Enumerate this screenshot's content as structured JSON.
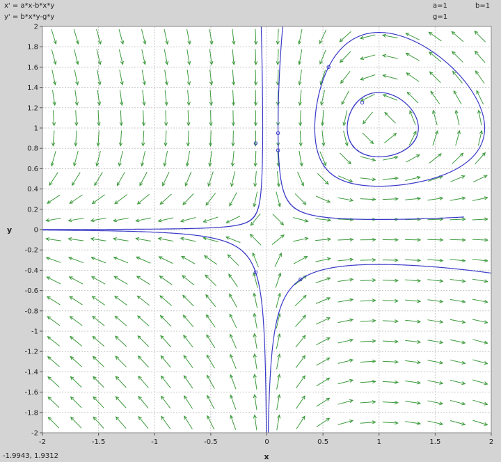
{
  "equations": {
    "x_dot": "x' = a*x-b*x*y",
    "y_dot": "y' = b*x*y-g*y"
  },
  "params": {
    "a": "a=1",
    "b": "b=1",
    "g": "g=1"
  },
  "cursor_readout": "-1.9943,  1.9312",
  "colors": {
    "background": "#d4d4d4",
    "plot_bg": "#ffffff",
    "grid": "#c8c8c8",
    "arrows": "#3c9a3c",
    "trajectories": "#3a3ac8"
  },
  "chart_data": {
    "type": "vector-field",
    "system": "Lotka-Volterra predator-prey",
    "params": {
      "a": 1,
      "b": 1,
      "g": 1
    },
    "xlabel": "x",
    "ylabel": "y",
    "xlim": [
      -2,
      2
    ],
    "ylim": [
      -2,
      2
    ],
    "xticks": [
      -2,
      -1.5,
      -1,
      -0.5,
      0,
      0.5,
      1,
      1.5,
      2
    ],
    "xtick_labels": [
      "-2",
      "-1.5",
      "-1",
      "-0.5",
      "0",
      "0.5",
      "1",
      "1.5",
      "2"
    ],
    "yticks": [
      -2,
      -1.8,
      -1.6,
      -1.4,
      -1.2,
      -1,
      -0.8,
      -0.6,
      -0.4,
      -0.2,
      0,
      0.2,
      0.4,
      0.6,
      0.8,
      1,
      1.2,
      1.4,
      1.6,
      1.8,
      2
    ],
    "ytick_labels": [
      "-2",
      "-1.8",
      "-1.6",
      "-1.4",
      "-1.2",
      "-1",
      "-0.8",
      "-0.6",
      "-0.4",
      "-0.2",
      "0",
      "0.2",
      "0.4",
      "0.6",
      "0.8",
      "1",
      "1.2",
      "1.4",
      "1.6",
      "1.8",
      "2"
    ],
    "grid": true,
    "field": {
      "x_values": [
        -1.9,
        -1.7,
        -1.5,
        -1.3,
        -1.1,
        -0.9,
        -0.7,
        -0.5,
        -0.3,
        -0.1,
        0.1,
        0.3,
        0.5,
        0.7,
        0.9,
        1.1,
        1.3,
        1.5,
        1.7,
        1.9
      ],
      "y_values": [
        -1.9,
        -1.7,
        -1.5,
        -1.3,
        -1.1,
        -0.9,
        -0.7,
        -0.5,
        -0.3,
        -0.1,
        0.1,
        0.3,
        0.5,
        0.7,
        0.9,
        1.1,
        1.3,
        1.5,
        1.7,
        1.9
      ]
    },
    "trajectories": [
      {
        "start": [
          0.8,
          1.25
        ],
        "t_span": 6.5,
        "direction": "forward"
      },
      {
        "start": [
          0.55,
          1.6
        ],
        "t_span": 7.0,
        "direction": "forward"
      },
      {
        "start": [
          0.3,
          -0.49
        ],
        "t_span": 3.0,
        "direction": "both"
      },
      {
        "start": [
          0.1,
          0.95
        ],
        "t_span": 4.0,
        "direction": "both"
      },
      {
        "start": [
          -0.1,
          -0.42
        ],
        "t_span": 4.0,
        "direction": "both"
      },
      {
        "start": [
          -0.1,
          0.15
        ],
        "t_span": 4.0,
        "direction": "both"
      }
    ],
    "marked_points": [
      [
        0.1,
        0.95
      ],
      [
        0.1,
        0.78
      ],
      [
        0.3,
        -0.49
      ],
      [
        -0.1,
        -0.42
      ],
      [
        -0.1,
        0.85
      ],
      [
        0.55,
        1.6
      ],
      [
        0.85,
        1.25
      ]
    ]
  }
}
